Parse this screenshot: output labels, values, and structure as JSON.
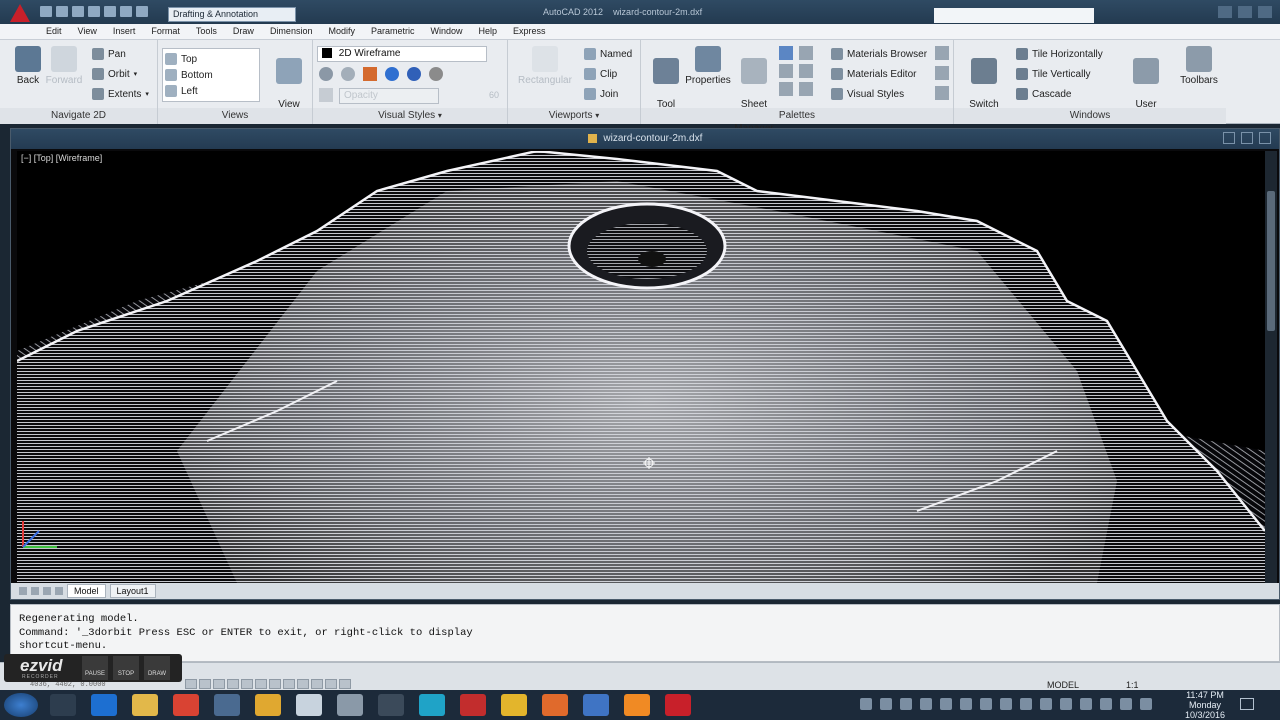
{
  "titlebar": {
    "workspace": "Drafting & Annotation",
    "app_name": "AutoCAD 2012",
    "file_name": "wizard-contour-2m.dxf"
  },
  "menu": [
    "Edit",
    "View",
    "Insert",
    "Format",
    "Tools",
    "Draw",
    "Dimension",
    "Modify",
    "Parametric",
    "Window",
    "Help",
    "Express"
  ],
  "ribbon": {
    "navigate": {
      "panel_label": "Navigate 2D",
      "back": "Back",
      "forward": "Forward",
      "pan": "Pan",
      "orbit": "Orbit",
      "extents": "Extents"
    },
    "views": {
      "panel_label": "Views",
      "top": "Top",
      "bottom": "Bottom",
      "left": "Left",
      "view_manager": "View\nManager"
    },
    "visual_styles": {
      "panel_label": "Visual Styles",
      "current": "2D Wireframe",
      "opacity_value": "60",
      "opacity_label": "Opacity"
    },
    "viewports": {
      "panel_label": "Viewports",
      "rectangular": "Rectangular",
      "named": "Named",
      "clip": "Clip",
      "join": "Join"
    },
    "palettes": {
      "panel_label": "Palettes",
      "tool_palettes": "Tool\nPalettes",
      "properties": "Properties",
      "sheet_set_manager": "Sheet Set\nManager",
      "materials_browser": "Materials Browser",
      "materials_editor": "Materials Editor",
      "visual_styles": "Visual Styles"
    },
    "windows": {
      "panel_label": "Windows",
      "switch_windows": "Switch\nWindows",
      "tile_horizontally": "Tile Horizontally",
      "tile_vertically": "Tile Vertically",
      "cascade": "Cascade",
      "user_interface": "User\nInterface",
      "toolbars": "Toolbars"
    }
  },
  "drawing": {
    "tab_title": "wizard-contour-2m.dxf",
    "viewport_label": "[−] [Top] [Wireframe]",
    "layout_tabs": [
      "Model",
      "Layout1"
    ]
  },
  "command_line": {
    "lines": [
      "Regenerating model.",
      "Command: '_3dorbit Press ESC or ENTER to exit, or right-click to display",
      "shortcut-menu."
    ]
  },
  "statusbar": {
    "coordinates": "4036, 4402, 0.0000",
    "model_label": "MODEL",
    "annotation_scale": "1:1"
  },
  "recorder": {
    "brand": "ezvid",
    "sub": "RECORDER",
    "pause": "PAUSE",
    "stop": "STOP",
    "draw": "DRAW"
  },
  "taskbar": {
    "time": "11:47 PM",
    "day": "Monday",
    "date": "10/3/2016"
  },
  "colors": {
    "autocad_red": "#c8202a",
    "titlebar": "#2f4a63",
    "viewport_bg": "#000000",
    "contour_lines": "#e8e8ee"
  }
}
